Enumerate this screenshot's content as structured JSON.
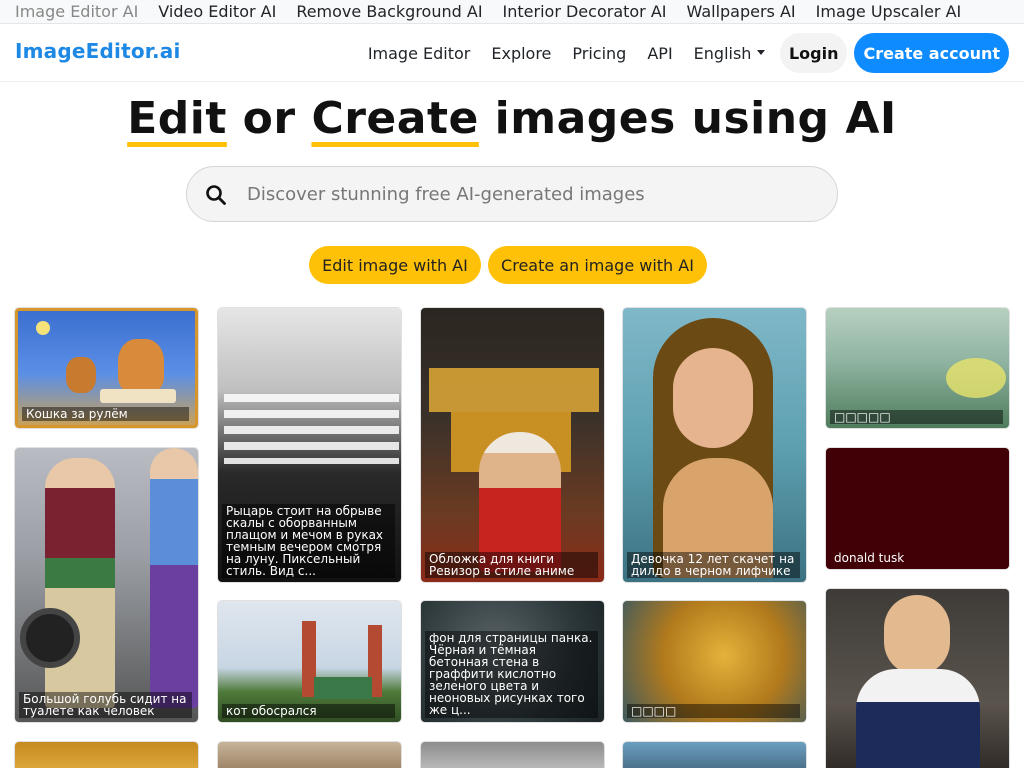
{
  "promo_links": [
    "Image Editor AI",
    "Video Editor AI",
    "Remove Background AI",
    "Interior Decorator AI",
    "Wallpapers AI",
    "Image Upscaler AI"
  ],
  "nav": {
    "brand": "ImageEditor.ai",
    "links": [
      "Image Editor",
      "Explore",
      "Pricing",
      "API"
    ],
    "language": "English",
    "login": "Login",
    "create_account": "Create account"
  },
  "hero": {
    "word1": "Edit",
    "word2": " or ",
    "word3": "Create",
    "word4": " images using AI"
  },
  "search": {
    "placeholder": "Discover stunning free AI-generated images"
  },
  "actions": {
    "edit": "Edit image with AI",
    "create": "Create an image with AI"
  },
  "gallery": [
    {
      "caption": "Кошка за рулём"
    },
    {
      "caption": "Большой голубь сидит на туалете как человек"
    },
    {
      "caption": "Рыцарь стоит на обрыве скалы с оборванным плащом и мечом в руках темным вечером смотря на луну. Пиксельный стиль. Вид с..."
    },
    {
      "caption": "кот обосрался"
    },
    {
      "caption": "Обложка для книги Ревизор в стиле аниме"
    },
    {
      "caption": "фон для страницы панка. Чёрная и тёмная бетонная стена в граффити кислотно зеленого цвета и неоновых рисунках того же ц..."
    },
    {
      "caption": "Девочка 12 лет скачет на дилдо в черном лифчике"
    },
    {
      "caption": "□□□□"
    },
    {
      "caption": "□□□□□"
    },
    {
      "caption": "donald tusk"
    }
  ],
  "colors": {
    "brand": "#1e88e5",
    "primary_button": "#0d8bff",
    "accent": "#ffc107"
  }
}
